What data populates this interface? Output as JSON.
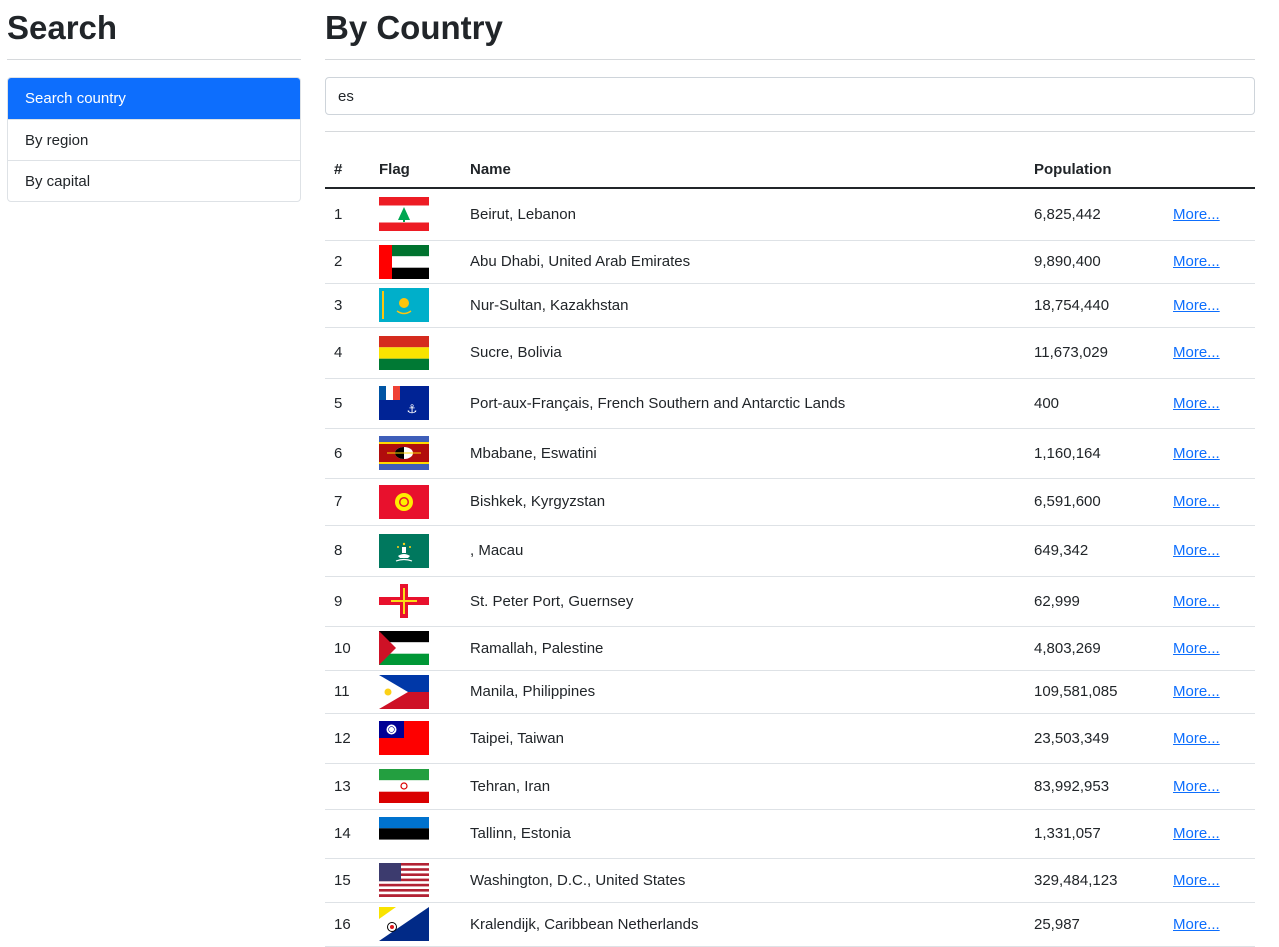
{
  "sidebar": {
    "title": "Search",
    "items": [
      {
        "label": "Search country",
        "active": true
      },
      {
        "label": "By region",
        "active": false
      },
      {
        "label": "By capital",
        "active": false
      }
    ]
  },
  "main": {
    "title": "By Country",
    "search": {
      "value": "es"
    },
    "table": {
      "headers": [
        "#",
        "Flag",
        "Name",
        "Population",
        ""
      ],
      "more_label": "More...",
      "rows": [
        {
          "num": "1",
          "flag": "lebanon-flag",
          "name": "Beirut, Lebanon",
          "population": "6,825,442"
        },
        {
          "num": "2",
          "flag": "uae-flag",
          "name": "Abu Dhabi, United Arab Emirates",
          "population": "9,890,400"
        },
        {
          "num": "3",
          "flag": "kazakhstan-flag",
          "name": "Nur-Sultan, Kazakhstan",
          "population": "18,754,440"
        },
        {
          "num": "4",
          "flag": "bolivia-flag",
          "name": "Sucre, Bolivia",
          "population": "11,673,029"
        },
        {
          "num": "5",
          "flag": "french-southern-lands-flag",
          "name": "Port-aux-Français, French Southern and Antarctic Lands",
          "population": "400"
        },
        {
          "num": "6",
          "flag": "eswatini-flag",
          "name": "Mbabane, Eswatini",
          "population": "1,160,164"
        },
        {
          "num": "7",
          "flag": "kyrgyzstan-flag",
          "name": "Bishkek, Kyrgyzstan",
          "population": "6,591,600"
        },
        {
          "num": "8",
          "flag": "macau-flag",
          "name": ", Macau",
          "population": "649,342"
        },
        {
          "num": "9",
          "flag": "guernsey-flag",
          "name": "St. Peter Port, Guernsey",
          "population": "62,999"
        },
        {
          "num": "10",
          "flag": "palestine-flag",
          "name": "Ramallah, Palestine",
          "population": "4,803,269"
        },
        {
          "num": "11",
          "flag": "philippines-flag",
          "name": "Manila, Philippines",
          "population": "109,581,085"
        },
        {
          "num": "12",
          "flag": "taiwan-flag",
          "name": "Taipei, Taiwan",
          "population": "23,503,349"
        },
        {
          "num": "13",
          "flag": "iran-flag",
          "name": "Tehran, Iran",
          "population": "83,992,953"
        },
        {
          "num": "14",
          "flag": "estonia-flag",
          "name": "Tallinn, Estonia",
          "population": "1,331,057"
        },
        {
          "num": "15",
          "flag": "united-states-flag",
          "name": "Washington, D.C., United States",
          "population": "329,484,123"
        },
        {
          "num": "16",
          "flag": "caribbean-netherlands-flag",
          "name": "Kralendijk, Caribbean Netherlands",
          "population": "25,987"
        }
      ]
    }
  },
  "colors": {
    "accent": "#0d6efd",
    "link": "#0d6efd",
    "text": "#212529",
    "border": "#dee2e6"
  }
}
